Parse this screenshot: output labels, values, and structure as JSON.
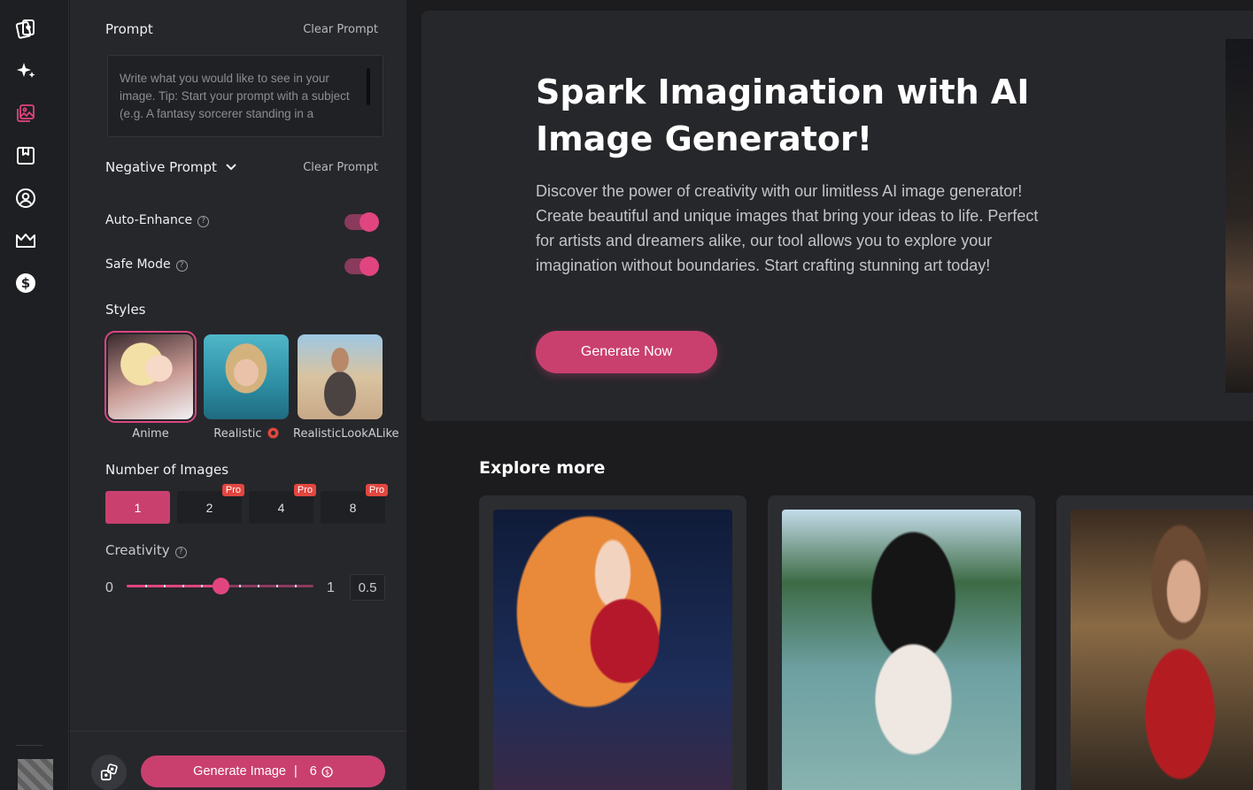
{
  "sidebar": {
    "icons": [
      "cards-icon",
      "sparkles-icon",
      "image-generator-icon",
      "bookmark-icon",
      "profile-icon",
      "crown-icon",
      "dollar-icon"
    ]
  },
  "panel": {
    "prompt_label": "Prompt",
    "clear_prompt": "Clear Prompt",
    "prompt_placeholder": "Write what you would like to see in your image. Tip: Start your prompt with a subject (e.g. A fantasy sorcerer standing in a",
    "negative_prompt_label": "Negative Prompt",
    "negative_clear_prompt": "Clear Prompt",
    "auto_enhance_label": "Auto-Enhance",
    "safe_mode_label": "Safe Mode",
    "styles_label": "Styles",
    "styles": [
      {
        "name": "Anime"
      },
      {
        "name": "Realistic"
      },
      {
        "name": "RealisticLookALike"
      }
    ],
    "number_label": "Number of Images",
    "numbers": [
      {
        "value": "1",
        "pro": ""
      },
      {
        "value": "2",
        "pro": "Pro"
      },
      {
        "value": "4",
        "pro": "Pro"
      },
      {
        "value": "8",
        "pro": "Pro"
      }
    ],
    "creativity_label": "Creativity",
    "creativity_min": "0",
    "creativity_max": "1",
    "creativity_value": "0.5",
    "creativity_fraction": 0.5,
    "generate_label": "Generate Image",
    "generate_cost": "6"
  },
  "hero": {
    "title": "Spark Imagination with AI Image Generator!",
    "description": "Discover the power of creativity with our limitless AI image generator! Create beautiful and unique images that bring your ideas to life. Perfect for artists and dreamers alike, our tool allows you to explore your imagination without boundaries. Start crafting stunning art today!",
    "cta": "Generate Now"
  },
  "explore": {
    "title": "Explore more"
  },
  "colors": {
    "accent": "#c9406f",
    "pro_badge": "#e2463f"
  }
}
